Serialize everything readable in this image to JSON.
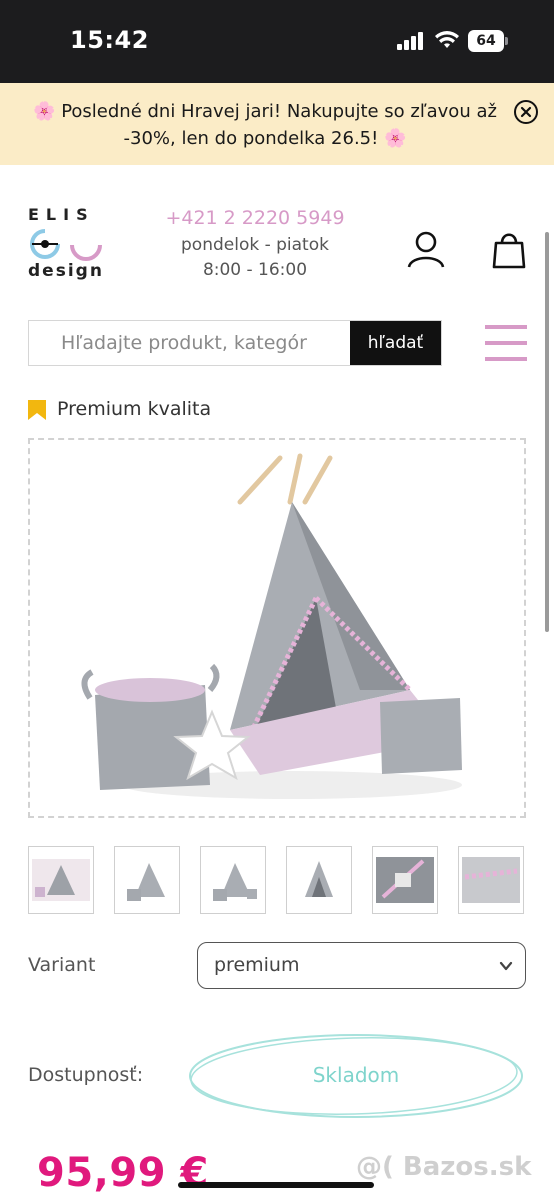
{
  "status_bar": {
    "time": "15:42",
    "battery": "64"
  },
  "promo": {
    "text": "🌸 Posledné dni Hravej jari! Nakupujte so zľavou až -30%, len do pondelka 26.5! 🌸",
    "close_icon": "close-circle-icon"
  },
  "header": {
    "logo": {
      "top": "ELIS",
      "bottom": "design"
    },
    "phone": "+421 2 2220 5949",
    "hours_days": "pondelok - piatok",
    "hours_time": "8:00 - 16:00",
    "icons": [
      "user-icon",
      "shopping-bag-icon"
    ]
  },
  "search": {
    "placeholder": "Hľadajte produkt, kategór",
    "button_label": "hľadať"
  },
  "product": {
    "badge": "Premium kvalita",
    "thumbnail_count": 6,
    "variant_label": "Variant",
    "variant_value": "premium",
    "availability_label": "Dostupnosť:",
    "availability_value": "Skladom",
    "price": "95,99 €"
  },
  "watermark": "@( Bazos.sk",
  "colors": {
    "brand_pink": "#d79ac7",
    "price_pink": "#e0197d",
    "availability_teal": "#7fd4cc",
    "promo_bg": "#fbecc7",
    "badge_yellow": "#f2b70f"
  }
}
